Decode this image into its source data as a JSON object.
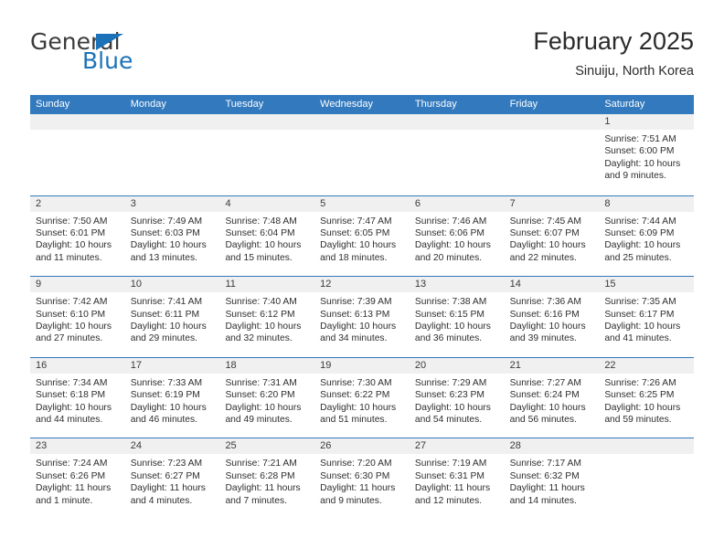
{
  "brand": {
    "name_top": "General",
    "name_bottom": "Blue",
    "accent_color": "#1b72b8"
  },
  "header": {
    "title": "February 2025",
    "location": "Sinuiju, North Korea"
  },
  "calendar": {
    "header_bg": "#3279bd",
    "daynum_bg": "#f0f0f0",
    "weekday_headers": [
      "Sunday",
      "Monday",
      "Tuesday",
      "Wednesday",
      "Thursday",
      "Friday",
      "Saturday"
    ],
    "weeks": [
      [
        {
          "day": "",
          "sunrise": "",
          "sunset": "",
          "daylight": ""
        },
        {
          "day": "",
          "sunrise": "",
          "sunset": "",
          "daylight": ""
        },
        {
          "day": "",
          "sunrise": "",
          "sunset": "",
          "daylight": ""
        },
        {
          "day": "",
          "sunrise": "",
          "sunset": "",
          "daylight": ""
        },
        {
          "day": "",
          "sunrise": "",
          "sunset": "",
          "daylight": ""
        },
        {
          "day": "",
          "sunrise": "",
          "sunset": "",
          "daylight": ""
        },
        {
          "day": "1",
          "sunrise": "Sunrise: 7:51 AM",
          "sunset": "Sunset: 6:00 PM",
          "daylight": "Daylight: 10 hours and 9 minutes."
        }
      ],
      [
        {
          "day": "2",
          "sunrise": "Sunrise: 7:50 AM",
          "sunset": "Sunset: 6:01 PM",
          "daylight": "Daylight: 10 hours and 11 minutes."
        },
        {
          "day": "3",
          "sunrise": "Sunrise: 7:49 AM",
          "sunset": "Sunset: 6:03 PM",
          "daylight": "Daylight: 10 hours and 13 minutes."
        },
        {
          "day": "4",
          "sunrise": "Sunrise: 7:48 AM",
          "sunset": "Sunset: 6:04 PM",
          "daylight": "Daylight: 10 hours and 15 minutes."
        },
        {
          "day": "5",
          "sunrise": "Sunrise: 7:47 AM",
          "sunset": "Sunset: 6:05 PM",
          "daylight": "Daylight: 10 hours and 18 minutes."
        },
        {
          "day": "6",
          "sunrise": "Sunrise: 7:46 AM",
          "sunset": "Sunset: 6:06 PM",
          "daylight": "Daylight: 10 hours and 20 minutes."
        },
        {
          "day": "7",
          "sunrise": "Sunrise: 7:45 AM",
          "sunset": "Sunset: 6:07 PM",
          "daylight": "Daylight: 10 hours and 22 minutes."
        },
        {
          "day": "8",
          "sunrise": "Sunrise: 7:44 AM",
          "sunset": "Sunset: 6:09 PM",
          "daylight": "Daylight: 10 hours and 25 minutes."
        }
      ],
      [
        {
          "day": "9",
          "sunrise": "Sunrise: 7:42 AM",
          "sunset": "Sunset: 6:10 PM",
          "daylight": "Daylight: 10 hours and 27 minutes."
        },
        {
          "day": "10",
          "sunrise": "Sunrise: 7:41 AM",
          "sunset": "Sunset: 6:11 PM",
          "daylight": "Daylight: 10 hours and 29 minutes."
        },
        {
          "day": "11",
          "sunrise": "Sunrise: 7:40 AM",
          "sunset": "Sunset: 6:12 PM",
          "daylight": "Daylight: 10 hours and 32 minutes."
        },
        {
          "day": "12",
          "sunrise": "Sunrise: 7:39 AM",
          "sunset": "Sunset: 6:13 PM",
          "daylight": "Daylight: 10 hours and 34 minutes."
        },
        {
          "day": "13",
          "sunrise": "Sunrise: 7:38 AM",
          "sunset": "Sunset: 6:15 PM",
          "daylight": "Daylight: 10 hours and 36 minutes."
        },
        {
          "day": "14",
          "sunrise": "Sunrise: 7:36 AM",
          "sunset": "Sunset: 6:16 PM",
          "daylight": "Daylight: 10 hours and 39 minutes."
        },
        {
          "day": "15",
          "sunrise": "Sunrise: 7:35 AM",
          "sunset": "Sunset: 6:17 PM",
          "daylight": "Daylight: 10 hours and 41 minutes."
        }
      ],
      [
        {
          "day": "16",
          "sunrise": "Sunrise: 7:34 AM",
          "sunset": "Sunset: 6:18 PM",
          "daylight": "Daylight: 10 hours and 44 minutes."
        },
        {
          "day": "17",
          "sunrise": "Sunrise: 7:33 AM",
          "sunset": "Sunset: 6:19 PM",
          "daylight": "Daylight: 10 hours and 46 minutes."
        },
        {
          "day": "18",
          "sunrise": "Sunrise: 7:31 AM",
          "sunset": "Sunset: 6:20 PM",
          "daylight": "Daylight: 10 hours and 49 minutes."
        },
        {
          "day": "19",
          "sunrise": "Sunrise: 7:30 AM",
          "sunset": "Sunset: 6:22 PM",
          "daylight": "Daylight: 10 hours and 51 minutes."
        },
        {
          "day": "20",
          "sunrise": "Sunrise: 7:29 AM",
          "sunset": "Sunset: 6:23 PM",
          "daylight": "Daylight: 10 hours and 54 minutes."
        },
        {
          "day": "21",
          "sunrise": "Sunrise: 7:27 AM",
          "sunset": "Sunset: 6:24 PM",
          "daylight": "Daylight: 10 hours and 56 minutes."
        },
        {
          "day": "22",
          "sunrise": "Sunrise: 7:26 AM",
          "sunset": "Sunset: 6:25 PM",
          "daylight": "Daylight: 10 hours and 59 minutes."
        }
      ],
      [
        {
          "day": "23",
          "sunrise": "Sunrise: 7:24 AM",
          "sunset": "Sunset: 6:26 PM",
          "daylight": "Daylight: 11 hours and 1 minute."
        },
        {
          "day": "24",
          "sunrise": "Sunrise: 7:23 AM",
          "sunset": "Sunset: 6:27 PM",
          "daylight": "Daylight: 11 hours and 4 minutes."
        },
        {
          "day": "25",
          "sunrise": "Sunrise: 7:21 AM",
          "sunset": "Sunset: 6:28 PM",
          "daylight": "Daylight: 11 hours and 7 minutes."
        },
        {
          "day": "26",
          "sunrise": "Sunrise: 7:20 AM",
          "sunset": "Sunset: 6:30 PM",
          "daylight": "Daylight: 11 hours and 9 minutes."
        },
        {
          "day": "27",
          "sunrise": "Sunrise: 7:19 AM",
          "sunset": "Sunset: 6:31 PM",
          "daylight": "Daylight: 11 hours and 12 minutes."
        },
        {
          "day": "28",
          "sunrise": "Sunrise: 7:17 AM",
          "sunset": "Sunset: 6:32 PM",
          "daylight": "Daylight: 11 hours and 14 minutes."
        },
        {
          "day": "",
          "sunrise": "",
          "sunset": "",
          "daylight": ""
        }
      ]
    ]
  }
}
